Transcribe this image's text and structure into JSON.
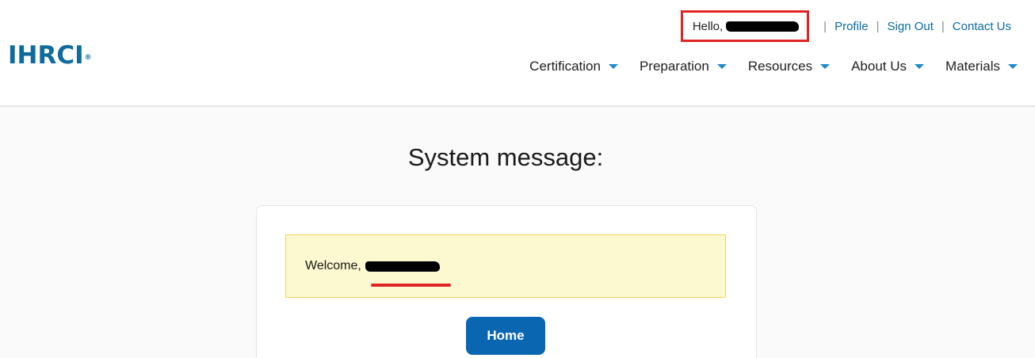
{
  "header": {
    "logo_text": "IHRCI",
    "logo_mark": "®",
    "greeting_prefix": "Hello,",
    "util_links": [
      {
        "label": "Profile"
      },
      {
        "label": "Sign Out"
      },
      {
        "label": "Contact Us"
      }
    ],
    "separator": "|",
    "nav": [
      {
        "label": "Certification",
        "icon": "caret-down-icon"
      },
      {
        "label": "Preparation",
        "icon": "caret-down-icon"
      },
      {
        "label": "Resources",
        "icon": "caret-down-icon"
      },
      {
        "label": "About Us",
        "icon": "caret-down-icon"
      },
      {
        "label": "Materials",
        "icon": "caret-down-icon"
      }
    ]
  },
  "main": {
    "title": "System message:",
    "alert_prefix": "Welcome,",
    "home_button": "Home"
  },
  "colors": {
    "brand": "#0f6b9c",
    "link": "#0a6aa1",
    "button": "#0b66b2",
    "annotation_red": "#e02424",
    "alert_bg": "#fcf8cf"
  }
}
